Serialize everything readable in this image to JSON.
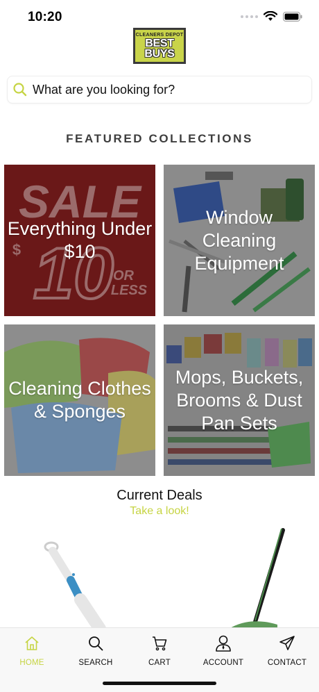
{
  "status_bar": {
    "time": "10:20"
  },
  "logo": {
    "top_text": "CLEANERS DEPOT",
    "line1": "BEST",
    "line2": "BUYS"
  },
  "search": {
    "placeholder": "What are you looking for?"
  },
  "featured": {
    "title": "FEATURED COLLECTIONS",
    "collections": [
      {
        "label": "Everything Under $10",
        "bg_text_1": "SALE",
        "bg_text_2": "10",
        "bg_text_3": "OR",
        "bg_text_4": "LESS",
        "bg_text_5": "$"
      },
      {
        "label": "Window Cleaning Equipment"
      },
      {
        "label": "Cleaning Clothes & Sponges"
      },
      {
        "label": "Mops, Buckets, Brooms & Dust Pan Sets"
      }
    ]
  },
  "deals": {
    "title": "Current Deals",
    "link": "Take a look!"
  },
  "tabs": [
    {
      "label": "HOME",
      "icon": "home-icon",
      "active": true
    },
    {
      "label": "SEARCH",
      "icon": "search-icon",
      "active": false
    },
    {
      "label": "CART",
      "icon": "cart-icon",
      "active": false
    },
    {
      "label": "ACCOUNT",
      "icon": "account-icon",
      "active": false
    },
    {
      "label": "CONTACT",
      "icon": "send-icon",
      "active": false
    }
  ],
  "colors": {
    "accent": "#c6d443",
    "sale_red": "#6e1b1b",
    "title_gray": "#3d3d3d"
  }
}
